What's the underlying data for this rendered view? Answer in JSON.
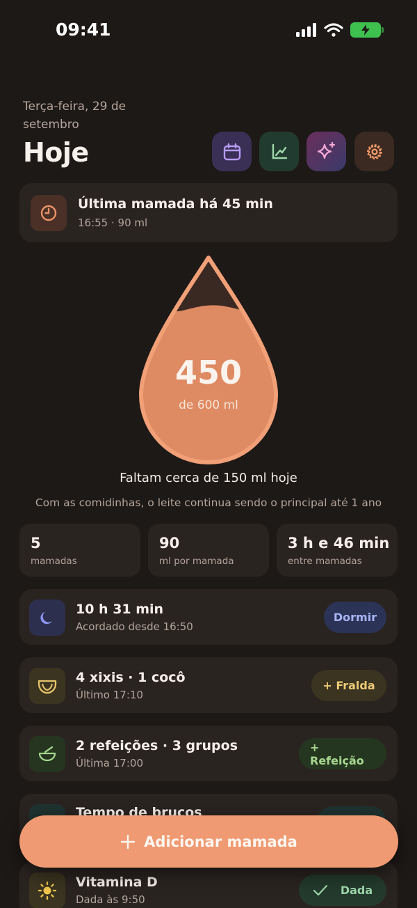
{
  "status_bar": {
    "time": "09:41"
  },
  "header": {
    "date": "Terça-feira, 29 de setembro",
    "title": "Hoje"
  },
  "last_feed": {
    "title": "Última mamada há 45 min",
    "subtitle": "16:55 · 90 ml"
  },
  "drop": {
    "amount": "450",
    "goal": "de 600 ml",
    "progress": 0.75
  },
  "remaining_text": "Faltam cerca de 150 ml hoje",
  "note_text": "Com as comidinhas, o leite continua sendo o principal até 1 ano",
  "stats": [
    {
      "value": "5",
      "label": "mamadas"
    },
    {
      "value": "90",
      "label": "ml por mamada"
    },
    {
      "value": "3 h e 46 min",
      "label": "entre mamadas"
    }
  ],
  "sleep": {
    "title": "10 h 31 min",
    "subtitle": "Acordado desde 16:50",
    "action": "Dormir"
  },
  "diaper": {
    "title": "4 xixis · 1 cocô",
    "subtitle": "Último 17:10",
    "action": "+ Fralda"
  },
  "meal": {
    "title": "2 refeições · 3 grupos",
    "subtitle": "Última 17:00",
    "action": "+ Refeição"
  },
  "tummy": {
    "title": "Tempo de bruços"
  },
  "vitamin": {
    "title": "Vitamina D",
    "subtitle": "Dada às 9:50",
    "action": "Dada"
  },
  "fab": {
    "label": "Adicionar mamada"
  },
  "colors": {
    "background": "#1d1917",
    "card": "#2a2421",
    "accent": "#ef9a72",
    "drop_fill": "#de8a62"
  }
}
